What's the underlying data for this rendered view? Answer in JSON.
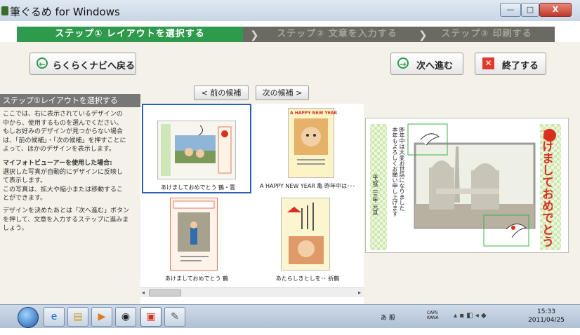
{
  "window": {
    "title": "筆ぐるめ for Windows",
    "minimize": "—",
    "maximize": "□",
    "close": "X"
  },
  "steps": [
    {
      "label": "ステップ① レイアウトを選択する",
      "active": true
    },
    {
      "label": "ステップ② 文章を入力する",
      "active": false
    },
    {
      "label": "ステップ③ 印刷する",
      "active": false
    }
  ],
  "toolbar": {
    "back_label": "らくらくナビへ戻る",
    "next_label": "次へ進む",
    "exit_label": "終了する"
  },
  "left_panel": {
    "heading": "ステップ①レイアウトを選択する",
    "para1": [
      "ここでは、右に表示されているデザインの",
      "中から、使用するものを選んでください。",
      "もしお好みのデザインが見つからない場合",
      "は、「前の候補」・「次の候補」を押すことに",
      "よって、ほかのデザインを表示します。"
    ],
    "para2_title": "マイフォトビューアーを使用した場合:",
    "para2": [
      "選択した写真が自動的にデザインに反映し",
      "て表示します。",
      "この写真は、拡大や縮小または移動するこ",
      "とができます。"
    ],
    "para3": [
      "デザインを決めたあとは「次へ進む」ボタン",
      "を押して、文章を入力するステップに進みま",
      "しょう。"
    ]
  },
  "candidates": {
    "prev_label": "< 前の候補",
    "next_label": "次の候補 >"
  },
  "designs": [
    {
      "caption": "あけましておめでとう 鶴・雲",
      "selected": true
    },
    {
      "caption": "A HAPPY NEW YEAR 亀 昨年中は･･･",
      "selected": false,
      "card_text": "A HAPPY NEW YEAR"
    },
    {
      "caption": "あけましておめでとう 鶴",
      "selected": false
    },
    {
      "caption": "あたらしきとしを･･ 折鶴",
      "selected": false
    }
  ],
  "preview": {
    "greeting_vertical": "あけましておめでとう",
    "message_col1": "昨年中は大変お世話になりました",
    "message_col2": "本年もよろしくお願い申し上げます",
    "date_text": "平成二三年 元旦"
  },
  "taskbar": {
    "clock_time": "15:33",
    "clock_date": "2011/04/25",
    "ime_text": "あ 般",
    "caps_text": "CAPS KANA"
  },
  "colors": {
    "accent_green": "#2e9a4c",
    "selection_blue": "#2b5fb3",
    "close_red": "#e03b2e",
    "greeting_red": "#d7301e"
  }
}
